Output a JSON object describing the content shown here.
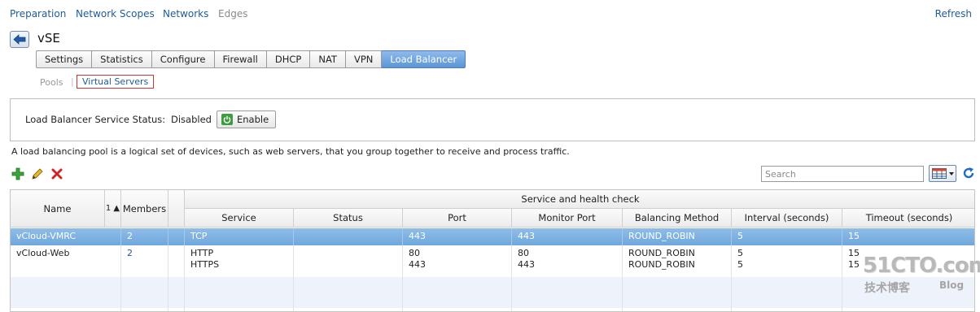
{
  "top_nav": {
    "items": [
      {
        "label": "Preparation",
        "dim": false
      },
      {
        "label": "Network Scopes",
        "dim": false
      },
      {
        "label": "Networks",
        "dim": false
      },
      {
        "label": "Edges",
        "dim": true
      }
    ],
    "refresh_label": "Refresh"
  },
  "edge": {
    "title": "vSE",
    "back_icon": "back-arrow-icon"
  },
  "tabs": [
    {
      "label": "Settings",
      "active": false
    },
    {
      "label": "Statistics",
      "active": false
    },
    {
      "label": "Configure",
      "active": false
    },
    {
      "label": "Firewall",
      "active": false
    },
    {
      "label": "DHCP",
      "active": false
    },
    {
      "label": "NAT",
      "active": false
    },
    {
      "label": "VPN",
      "active": false
    },
    {
      "label": "Load Balancer",
      "active": true
    }
  ],
  "subtabs": {
    "pools": "Pools",
    "separator": "|",
    "virtual_servers": "Virtual Servers",
    "selected": "Virtual Servers"
  },
  "status_panel": {
    "label": "Load Balancer Service Status:",
    "value": "Disabled",
    "enable_button": "Enable",
    "enable_icon": "power-icon"
  },
  "description": "A load balancing pool is a logical set of devices, such as web servers, that you group together to receive and process traffic.",
  "toolbar": {
    "add_icon": "add-icon",
    "edit_icon": "pencil-icon",
    "delete_icon": "delete-icon",
    "search_placeholder": "Search",
    "column_chooser_icon": "column-chooser-icon",
    "refresh_icon": "refresh-icon"
  },
  "grid": {
    "group_header": "Service and health check",
    "sort_indicator": "1 ▲",
    "columns": {
      "name": "Name",
      "members": "Members",
      "service": "Service",
      "status": "Status",
      "port": "Port",
      "monitor_port": "Monitor Port",
      "balancing_method": "Balancing Method",
      "interval": "Interval (seconds)",
      "timeout": "Timeout (seconds)"
    },
    "rows": [
      {
        "name": "vCloud-VMRC",
        "members": "2",
        "service": [
          "TCP"
        ],
        "status": "",
        "port": [
          "443"
        ],
        "monitor_port": [
          "443"
        ],
        "balancing_method": [
          "ROUND_ROBIN"
        ],
        "interval": [
          "5"
        ],
        "timeout": [
          "15"
        ],
        "selected": true
      },
      {
        "name": "vCloud-Web",
        "members": "2",
        "service": [
          "HTTP",
          "HTTPS"
        ],
        "status": "",
        "port": [
          "80",
          "443"
        ],
        "monitor_port": [
          "80",
          "443"
        ],
        "balancing_method": [
          "ROUND_ROBIN",
          "ROUND_ROBIN"
        ],
        "interval": [
          "5",
          "5"
        ],
        "timeout": [
          "15",
          "15"
        ],
        "selected": false
      }
    ]
  },
  "watermark": {
    "brand": "51CTO.com",
    "tagline": "技术博客",
    "blog": "Blog"
  },
  "colors": {
    "accent": "#1f5b98",
    "selected_row": "#7fb2e2",
    "active_tab": "#6fa3da",
    "power_green": "#3f9b3f"
  }
}
